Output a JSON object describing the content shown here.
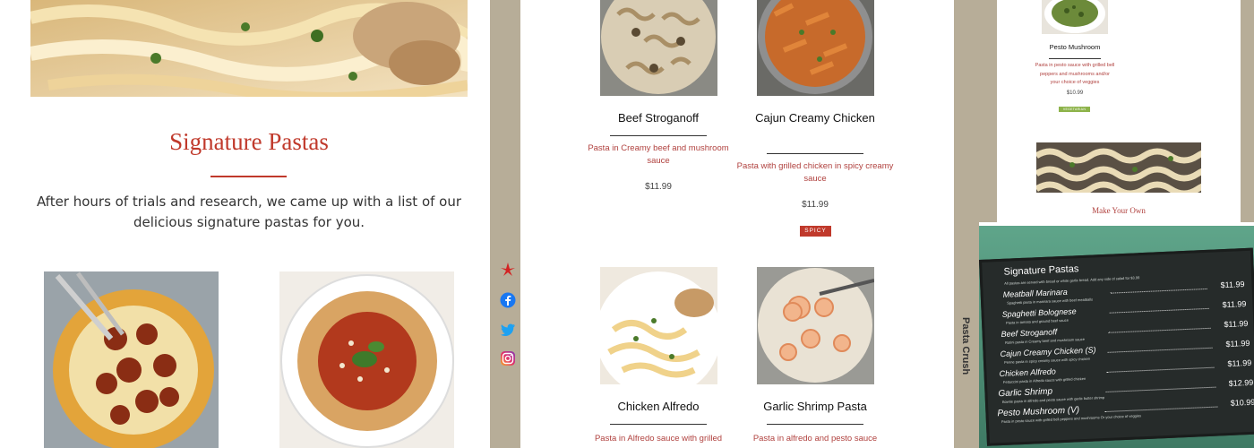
{
  "panel1": {
    "title": "Signature Pastas",
    "intro": "After hours of trials and research, we came up with a list of our delicious signature pastas for you."
  },
  "social": [
    "yelp-icon",
    "facebook-icon",
    "twitter-icon",
    "instagram-icon"
  ],
  "menu": {
    "items": [
      {
        "name": "Beef Stroganoff",
        "desc": "Pasta in Creamy beef and mushroom sauce",
        "price": "$11.99",
        "badge": ""
      },
      {
        "name": "Cajun Creamy Chicken",
        "desc": "Pasta with grilled chicken in spicy creamy sauce",
        "price": "$11.99",
        "badge": "SPICY"
      },
      {
        "name": "Chicken Alfredo",
        "desc": "Pasta in Alfredo sauce with grilled",
        "price": "",
        "badge": ""
      },
      {
        "name": "Garlic Shrimp Pasta",
        "desc": "Pasta in alfredo and pesto sauce",
        "price": "",
        "badge": ""
      }
    ]
  },
  "side_label": "Pasta Crush",
  "panel3": {
    "pesto": {
      "name": "Pesto Mushroom",
      "desc": "Pasta in pesto sauce with grilled bell peppers and mushrooms and/or your choice of veggies",
      "price": "$10.99",
      "badge": "VEGETARIAN"
    },
    "make_your_own": "Make Your Own",
    "chalkboard": {
      "title": "Signature Pastas",
      "subtitle": "All pastas are served with bread or white garlic bread. Add any side of salad for $3.99",
      "rows": [
        {
          "name": "Meatball Marinara",
          "price": "$11.99",
          "desc": "Spaghetti pasta in marinara sauce with beef meatballs"
        },
        {
          "name": "Spaghetti Bolognese",
          "price": "$11.99",
          "desc": "Pasta in tomato and ground beef sauce"
        },
        {
          "name": "Beef Stroganoff",
          "price": "$11.99",
          "desc": "Rotini pasta in Creamy beef and mushroom sauce"
        },
        {
          "name": "Cajun Creamy Chicken (S)",
          "price": "$11.99",
          "desc": "Penne pasta in spicy creamy sauce with spicy chicken"
        },
        {
          "name": "Chicken Alfredo",
          "price": "$11.99",
          "desc": "Fettuccini pasta in Alfredo sauce with grilled chicken"
        },
        {
          "name": "Garlic Shrimp",
          "price": "$12.99",
          "desc": "Bowtie pasta in alfredo and pesto sauce with garlic butter shrimp"
        },
        {
          "name": "Pesto Mushroom (V)",
          "price": "$10.99",
          "desc": "Pasta in pesto sauce with grilled bell peppers and mushrooms Or your choice of veggies"
        }
      ]
    }
  },
  "colors": {
    "accent": "#c0392b",
    "beige": "#b7ad98",
    "chalk": "#2f3a35"
  }
}
